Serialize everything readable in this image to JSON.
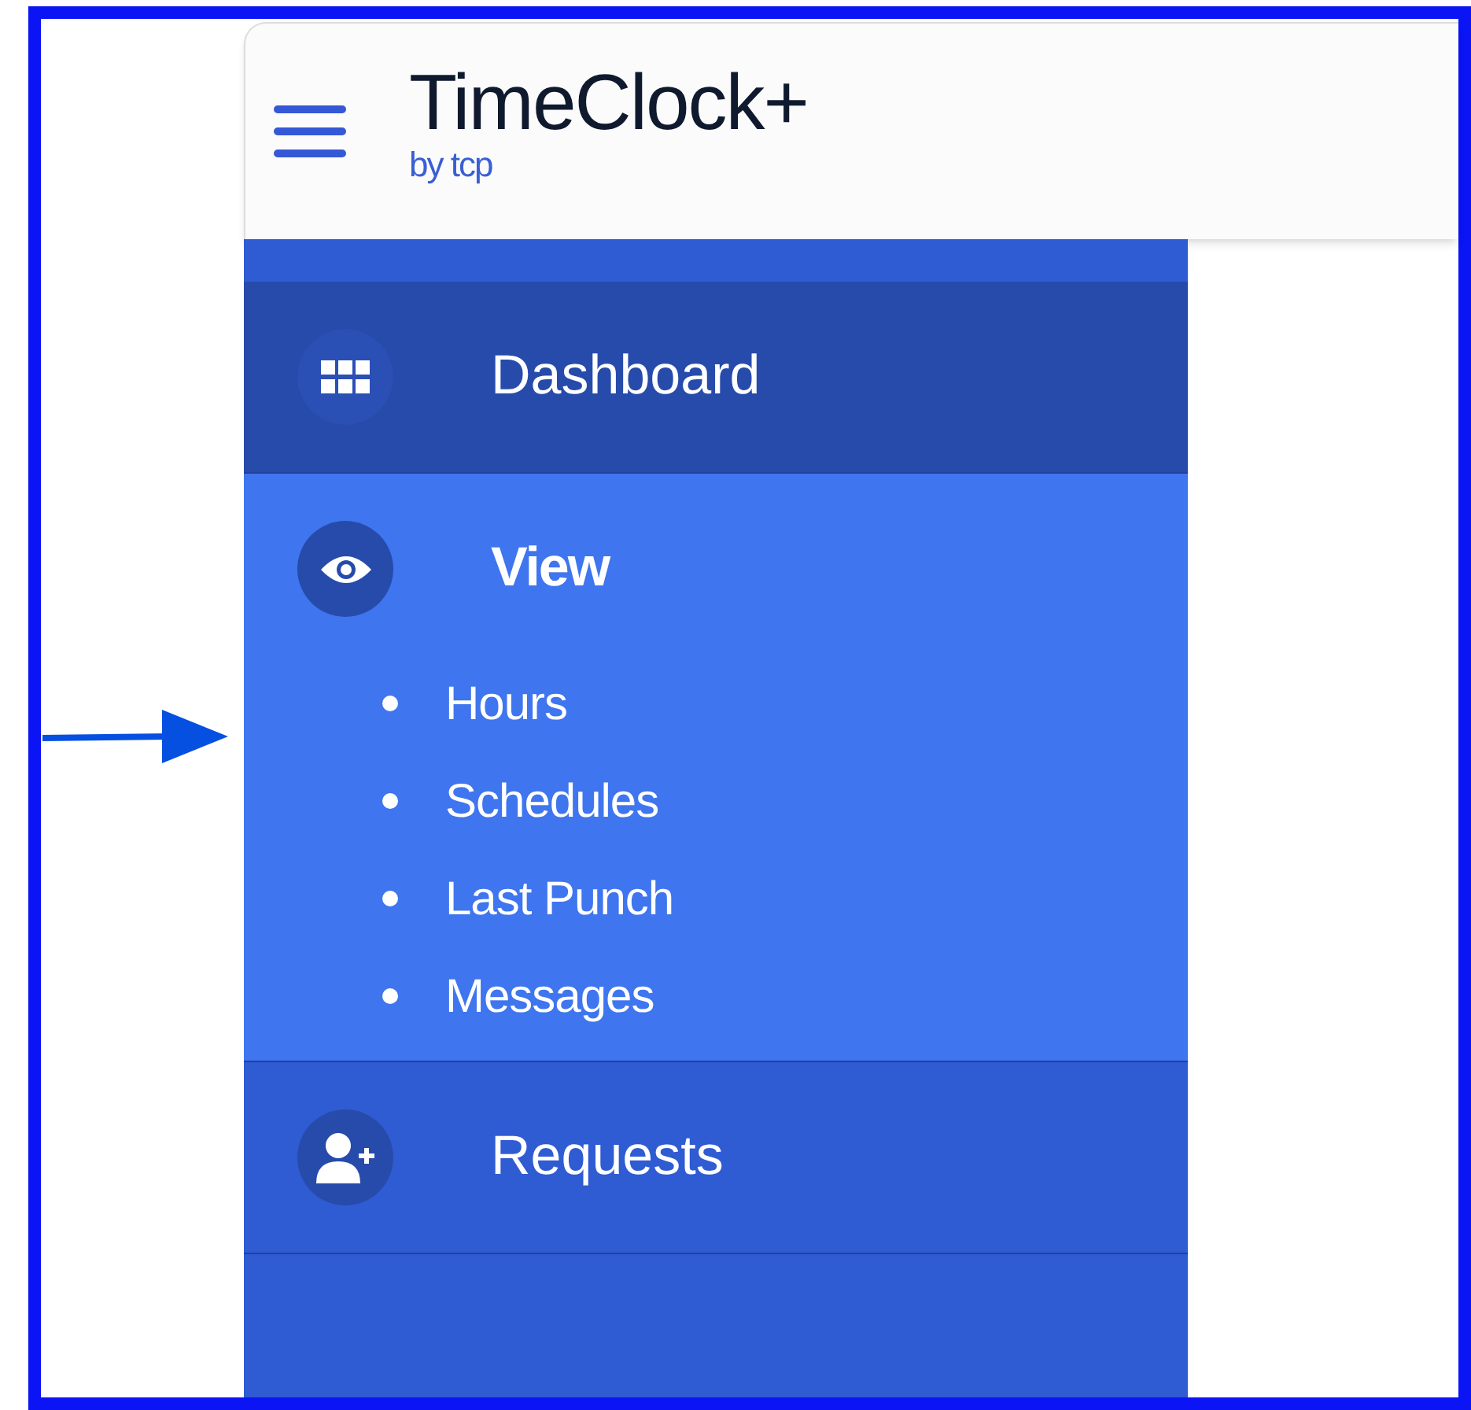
{
  "header": {
    "title": "TimeClock+",
    "subtitle": "by tcp"
  },
  "sidebar": {
    "items": [
      {
        "label": "Dashboard",
        "selected": false,
        "highlighted": true
      },
      {
        "label": "View",
        "selected": true,
        "highlighted": false,
        "children": [
          {
            "label": "Hours"
          },
          {
            "label": "Schedules"
          },
          {
            "label": "Last Punch"
          },
          {
            "label": "Messages"
          }
        ]
      },
      {
        "label": "Requests",
        "selected": false,
        "highlighted": false
      }
    ]
  }
}
